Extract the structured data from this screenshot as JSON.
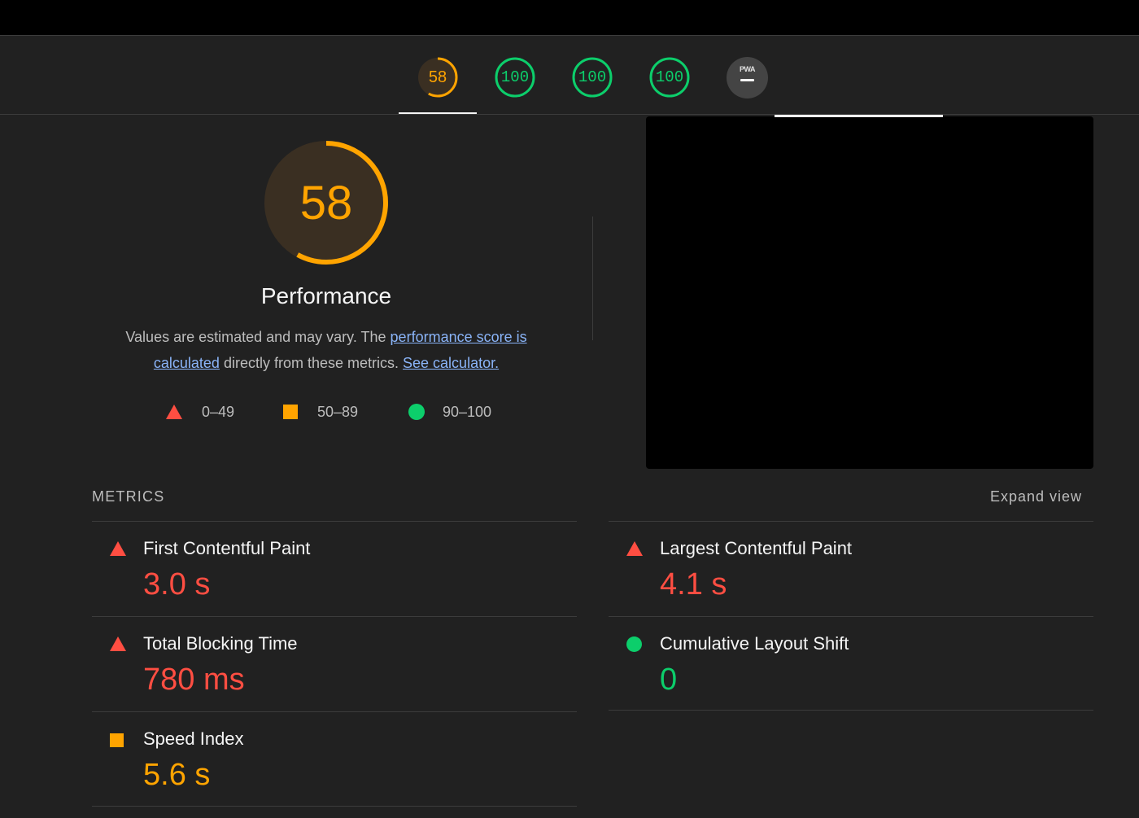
{
  "colors": {
    "fail": "#ff4e42",
    "average": "#ffa400",
    "pass": "#0cce6b",
    "link": "#8ab4f8",
    "background": "#212121"
  },
  "gauges": [
    {
      "label": "58",
      "score": 0.58,
      "rating": "average"
    },
    {
      "label": "100",
      "score": 1.0,
      "rating": "pass"
    },
    {
      "label": "100",
      "score": 1.0,
      "rating": "pass"
    },
    {
      "label": "100",
      "score": 1.0,
      "rating": "pass"
    }
  ],
  "pwa_badge": {
    "label": "PWA",
    "icon": "pwa-dash-icon"
  },
  "performance": {
    "score_label": "58",
    "score": 0.58,
    "title": "Performance",
    "desc_before": "Values are estimated and may vary. The ",
    "desc_link1": "performance score is calculated",
    "desc_middle": " directly from these metrics. ",
    "desc_link2": "See calculator."
  },
  "legend": [
    {
      "icon": "triangle-icon",
      "range": "0–49"
    },
    {
      "icon": "square-icon",
      "range": "50–89"
    },
    {
      "icon": "circle-icon",
      "range": "90–100"
    }
  ],
  "metrics_section": {
    "heading": "METRICS",
    "expand_label": "Expand view"
  },
  "metrics": [
    {
      "name": "First Contentful Paint",
      "value": "3.0 s",
      "rating": "fail"
    },
    {
      "name": "Largest Contentful Paint",
      "value": "4.1 s",
      "rating": "fail"
    },
    {
      "name": "Total Blocking Time",
      "value": "780 ms",
      "rating": "fail"
    },
    {
      "name": "Cumulative Layout Shift",
      "value": "0",
      "rating": "pass"
    },
    {
      "name": "Speed Index",
      "value": "5.6 s",
      "rating": "average"
    }
  ]
}
